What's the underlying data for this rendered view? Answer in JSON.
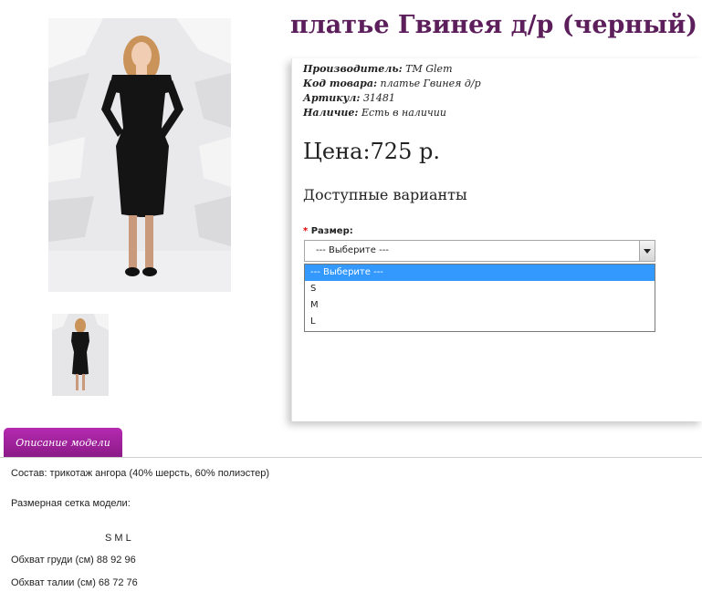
{
  "product": {
    "title": "платье Гвинея д/р (черный)",
    "meta": [
      {
        "key": "Производитель:",
        "value": "TM Glem"
      },
      {
        "key": "Код товара:",
        "value": "платье Гвинея д/р"
      },
      {
        "key": "Артикул:",
        "value": "31481"
      },
      {
        "key": "Наличие:",
        "value": "Есть в наличии"
      }
    ],
    "price": "Цена:725 р.",
    "variants_heading": "Доступные варианты"
  },
  "size_select": {
    "required_mark": "*",
    "label": "Размер:",
    "selected": "--- Выберите ---",
    "options": [
      "--- Выберите ---",
      "S",
      "M",
      "L"
    ],
    "highlighted_index": 0
  },
  "tabs": {
    "description_label": "Описание модели"
  },
  "description": {
    "composition": "Состав: трикотаж ангора (40% шерсть, 60% полиэстер)",
    "size_chart_heading": "Размерная сетка модели:",
    "size_header": "S  M  L",
    "rows": [
      "Обхват груди (см) 88 92 96",
      "Обхват талии (см) 68 72 76"
    ]
  },
  "colors": {
    "title": "#5c1f5b",
    "tab": "#8a1a86",
    "highlight": "#3399ff",
    "required": "#e00000"
  },
  "icons": [
    "dropdown-arrow-icon"
  ]
}
